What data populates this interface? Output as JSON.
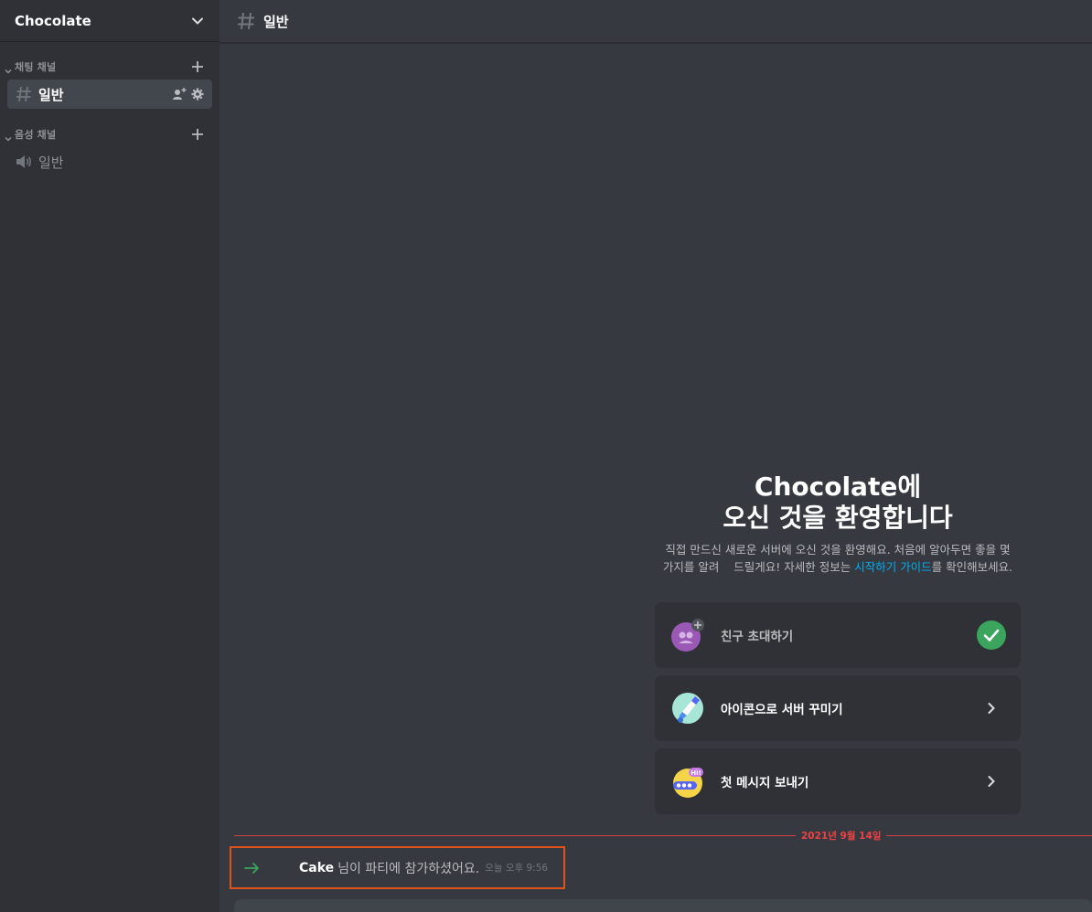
{
  "server": {
    "name": "Chocolate"
  },
  "sidebar": {
    "categories": [
      {
        "label": "채팅 채널"
      },
      {
        "label": "음성 채널"
      }
    ],
    "text_channel": {
      "label": "일반"
    },
    "voice_channel": {
      "label": "일반"
    }
  },
  "header": {
    "channel": "일반"
  },
  "welcome": {
    "title_line1": "Chocolate에",
    "title_line2": "오신 것을 환영합니다",
    "desc_line1": "직접 만드신 새로운 서버에 오신 것을 환영해요. 처음에 알아두면 좋을 몇",
    "desc_line2_pre": "가지를 알려    드릴게요! 자세한 정보는 ",
    "desc_link": "시작하기 가이드",
    "desc_line2_post": "를 확인해보세요."
  },
  "cards": [
    {
      "label": "친구 초대하기",
      "status": "done"
    },
    {
      "label": "아이콘으로 서버 꾸미기",
      "status": "todo"
    },
    {
      "label": "첫 메시지 보내기",
      "status": "todo"
    }
  ],
  "divider": {
    "date": "2021년 9월 14일"
  },
  "join": {
    "user": "Cake",
    "message": "님이 파티에 참가하셨어요.",
    "time": "오늘 오후 9:56"
  },
  "colors": {
    "accent_red": "#ed4245",
    "highlight_box": "#e0521c",
    "link": "#00aff4",
    "success_green": "#3ba55d"
  },
  "icons": {
    "server_menu": "chevron-down-icon",
    "text_channel": "hash-icon",
    "voice_channel": "speaker-icon",
    "invite": "add-member-icon",
    "settings": "gear-icon",
    "join": "arrow-right-icon"
  }
}
